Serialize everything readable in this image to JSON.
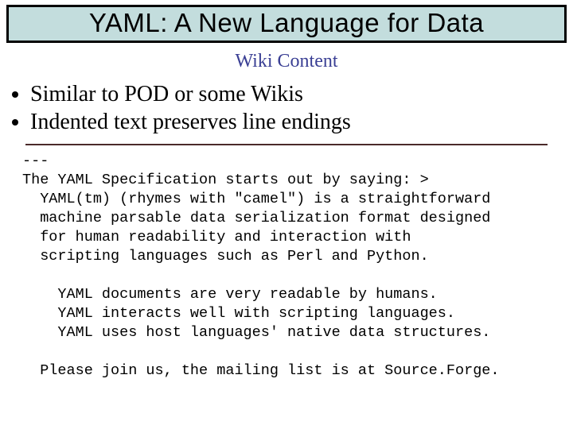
{
  "header": {
    "title": "YAML: A New Language for Data"
  },
  "subtitle": "Wiki Content",
  "bullets": [
    "Similar to POD or some Wikis",
    "Indented text preserves line endings"
  ],
  "code": "---\nThe YAML Specification starts out by saying: >\n  YAML(tm) (rhymes with \"camel\") is a straightforward\n  machine parsable data serialization format designed\n  for human readability and interaction with\n  scripting languages such as Perl and Python.\n\n    YAML documents are very readable by humans.\n    YAML interacts well with scripting languages.\n    YAML uses host languages' native data structures.\n\n  Please join us, the mailing list is at Source.Forge."
}
